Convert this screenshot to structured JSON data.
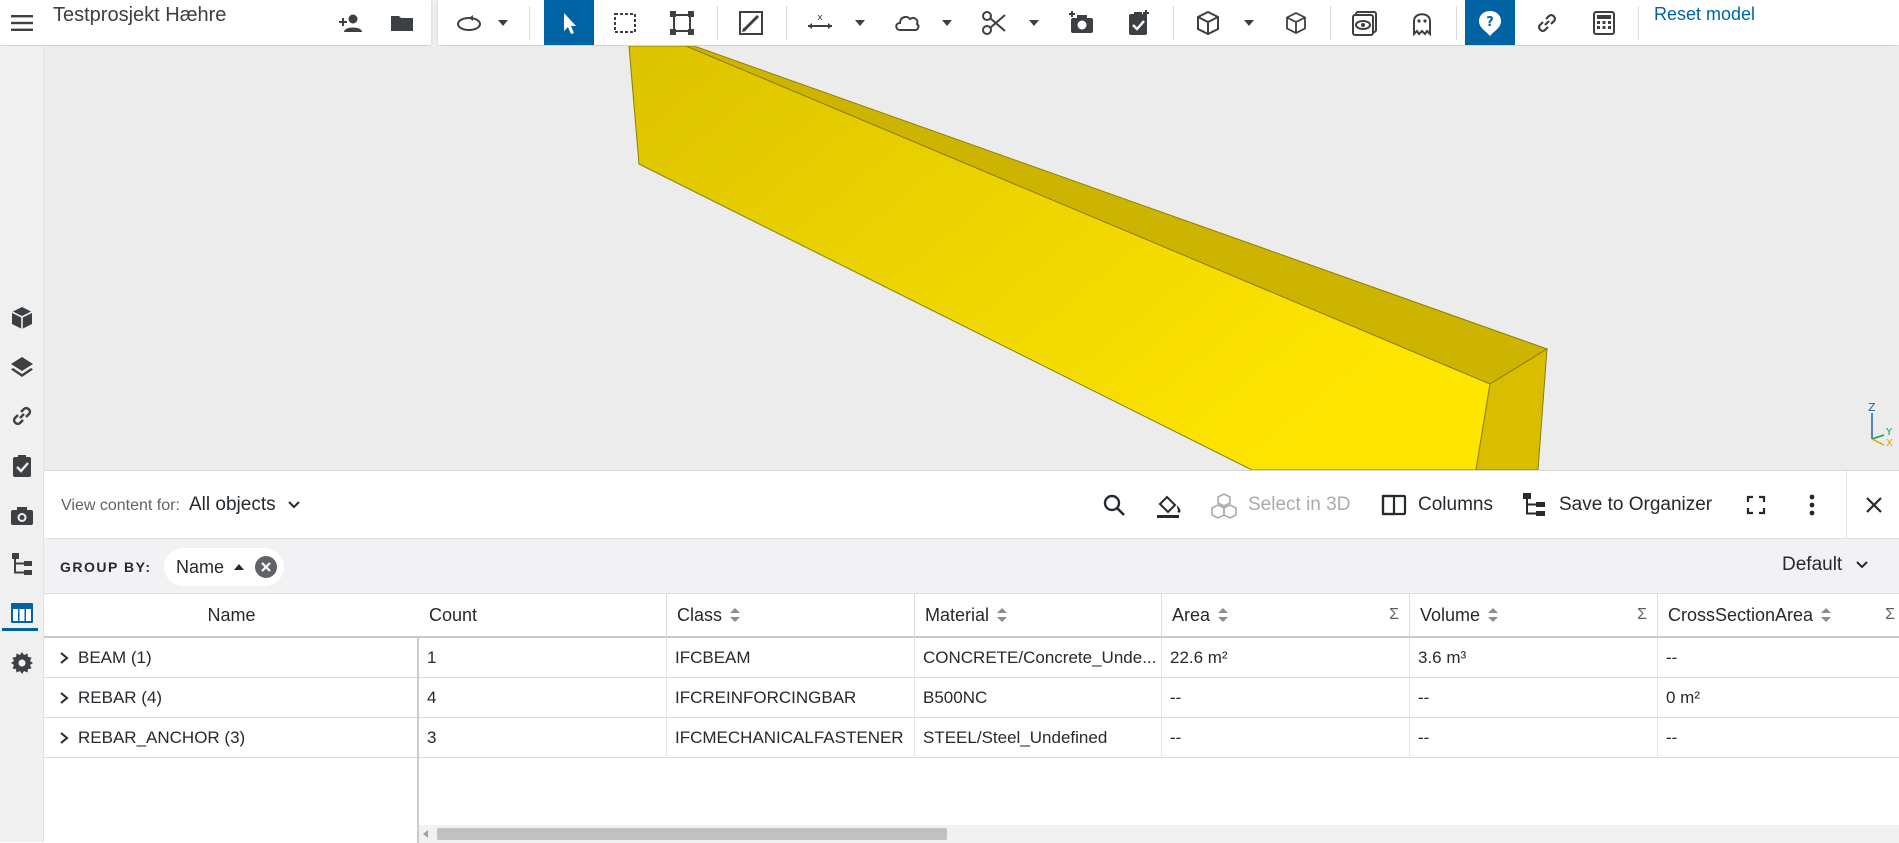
{
  "app": {
    "project_title": "Testprosjekt Hæhre",
    "reset_model_label": "Reset model",
    "accent": "#0063a3"
  },
  "toolbar": {
    "tools": [
      "menu-icon",
      "share-users-icon",
      "folder-icon",
      "orbit-icon",
      "select-icon",
      "box-select-icon",
      "fit-view-icon",
      "markup-icon",
      "measure-icon",
      "cloud-markup-icon",
      "section-icon",
      "snapshot-icon",
      "todo-icon",
      "view-cube-icon",
      "isometric-icon",
      "visibility-icon",
      "ghost-icon",
      "help-icon",
      "link-icon",
      "calculator-icon"
    ]
  },
  "left_rail": {
    "items": [
      "models-icon",
      "layers-icon",
      "links-icon",
      "todos-icon",
      "views-icon",
      "organizer-icon",
      "data-table-icon",
      "settings-icon"
    ],
    "active": "data-table-icon"
  },
  "viewport": {
    "beam_color": "#e8cf00",
    "axis_labels": {
      "z": "Z",
      "y": "Y",
      "x": "X"
    }
  },
  "panel": {
    "view_for_label": "View content for:",
    "view_for_value": "All objects",
    "actions": {
      "select_in_3d": "Select in 3D",
      "columns": "Columns",
      "save_to_organizer": "Save to Organizer"
    },
    "group_by": {
      "label": "GROUP BY:",
      "chip": "Name",
      "preset": "Default"
    }
  },
  "table": {
    "name_header": "Name",
    "columns": [
      {
        "key": "count",
        "label": "Count",
        "sortable": false,
        "sum": false
      },
      {
        "key": "class",
        "label": "Class",
        "sortable": true,
        "sum": false
      },
      {
        "key": "material",
        "label": "Material",
        "sortable": true,
        "sum": false
      },
      {
        "key": "area",
        "label": "Area",
        "sortable": true,
        "sum": true
      },
      {
        "key": "volume",
        "label": "Volume",
        "sortable": true,
        "sum": true
      },
      {
        "key": "csa",
        "label": "CrossSectionArea",
        "sortable": true,
        "sum": true
      }
    ],
    "sum_symbol": "Σ",
    "rows": [
      {
        "name": "BEAM (1)",
        "count": "1",
        "class": "IFCBEAM",
        "material": "CONCRETE/Concrete_Unde...",
        "area": "22.6 m²",
        "volume": "3.6 m³",
        "csa": "--"
      },
      {
        "name": "REBAR (4)",
        "count": "4",
        "class": "IFCREINFORCINGBAR",
        "material": "B500NC",
        "area": "--",
        "volume": "--",
        "csa": "0 m²"
      },
      {
        "name": "REBAR_ANCHOR (3)",
        "count": "3",
        "class": "IFCMECHANICALFASTENER",
        "material": "STEEL/Steel_Undefined",
        "area": "--",
        "volume": "--",
        "csa": "--"
      }
    ]
  }
}
